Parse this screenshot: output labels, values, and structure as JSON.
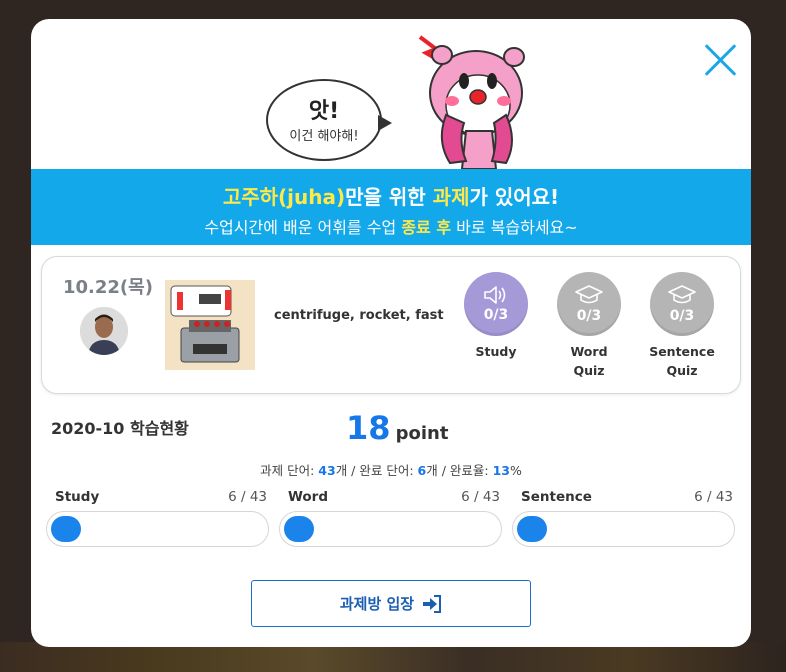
{
  "hero": {
    "bubble_big": "앗!",
    "bubble_small": "이건 해야해!"
  },
  "banner": {
    "name": "고주하(juha)",
    "mid": "만을 위한 ",
    "highlight": "과제",
    "end": "가 있어요!",
    "line2_start": "수업시간에 배운 어휘를 수업 ",
    "line2_highlight": "종료 후",
    "line2_end": " 바로 복습하세요~"
  },
  "lesson": {
    "date": "10.22(목)",
    "words": "centrifuge,  rocket,  fast",
    "badges": [
      {
        "count": "0/3",
        "label": "Study",
        "icon": "speaker-icon",
        "color": "#a59ad7"
      },
      {
        "count": "0/3",
        "label": "Word Quiz",
        "icon": "graduation-cap-icon",
        "color": "#b5b5b5"
      },
      {
        "count": "0/3",
        "label": "Sentence Quiz",
        "icon": "graduation-cap-icon",
        "color": "#b5b5b5"
      }
    ]
  },
  "stats": {
    "month_title": "2020-10 학습현황",
    "points_value": "18",
    "points_unit": "point",
    "summary_a": "과제 단어: ",
    "assigned": "43",
    "summary_b": "개 / 완료 단어: ",
    "completed": "6",
    "summary_c": "개 / 완료율: ",
    "rate": "13",
    "summary_d": "%",
    "progress": [
      {
        "name": "Study",
        "count": "6 / 43",
        "fraction": 0.14
      },
      {
        "name": "Word",
        "count": "6 / 43",
        "fraction": 0.14
      },
      {
        "name": "Sentence",
        "count": "6 / 43",
        "fraction": 0.14
      }
    ]
  },
  "actions": {
    "enter_label": "과제방 입장",
    "enter_icon": "sign-in-icon"
  },
  "colors": {
    "accent_blue": "#12a8ea",
    "progress_blue": "#1a84ea",
    "highlight_yellow": "#ffe94a",
    "close_blue": "#1ba7e6"
  }
}
